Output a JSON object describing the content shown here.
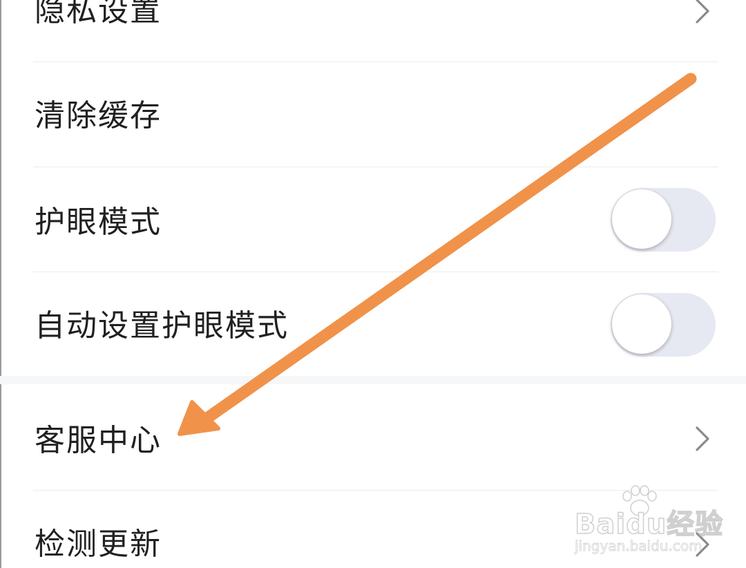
{
  "settings": {
    "items": [
      {
        "label": "隐私设置",
        "control": "chevron-right-icon"
      },
      {
        "label": "清除缓存",
        "control": "none"
      },
      {
        "label": "护眼模式",
        "control": "toggle",
        "enabled": false
      },
      {
        "label": "自动设置护眼模式",
        "control": "toggle",
        "enabled": false
      },
      {
        "label": "客服中心",
        "control": "chevron-right-icon"
      },
      {
        "label": "检测更新",
        "control": "chevron-right-icon"
      }
    ]
  },
  "annotation": {
    "arrow_color": "#f0924a",
    "points_to": "客服中心"
  },
  "watermark": {
    "logo": "Baidu经验",
    "url": "jingyan.baidu.com"
  },
  "colors": {
    "toggle_track": "#e6e8f2",
    "divider": "#ececef",
    "text": "#202020",
    "chevron": "#8a8a8a"
  }
}
